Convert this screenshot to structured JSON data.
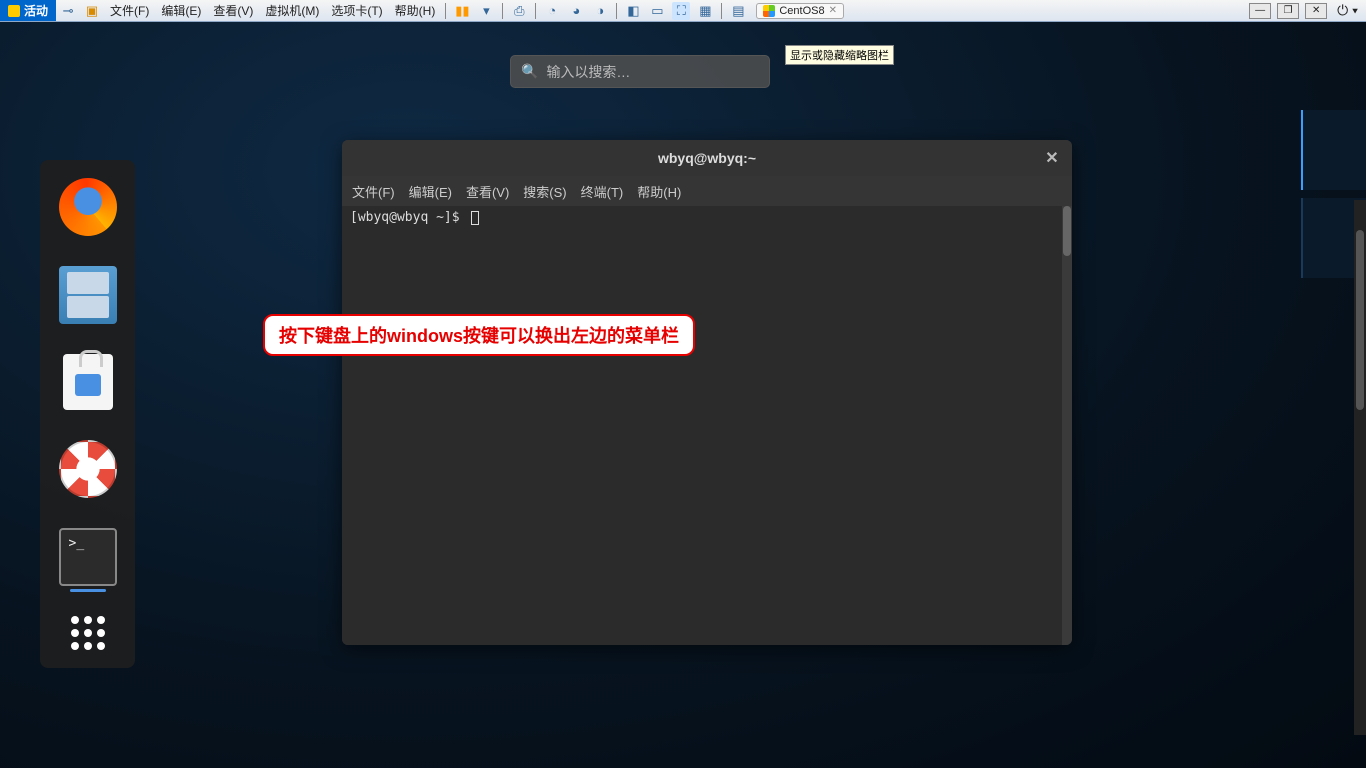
{
  "toolbar": {
    "activity": "活动",
    "menus": [
      "文件(F)",
      "编辑(E)",
      "查看(V)",
      "虚拟机(M)",
      "选项卡(T)",
      "帮助(H)"
    ],
    "tab_label": "CentOS8",
    "tooltip": "显示或隐藏缩略图栏"
  },
  "search": {
    "placeholder": "输入以搜索…"
  },
  "dock": {
    "items": [
      "firefox",
      "files",
      "software",
      "help",
      "terminal"
    ],
    "apps_label": "show-apps"
  },
  "terminal": {
    "title": "wbyq@wbyq:~",
    "menus": [
      "文件(F)",
      "编辑(E)",
      "查看(V)",
      "搜索(S)",
      "终端(T)",
      "帮助(H)"
    ],
    "prompt": "[wbyq@wbyq ~]$"
  },
  "annotation": "按下键盘上的windows按键可以换出左边的菜单栏"
}
